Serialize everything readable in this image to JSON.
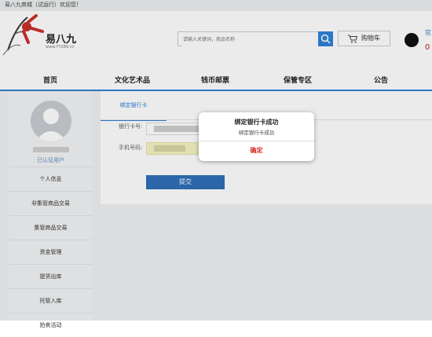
{
  "topbar": {
    "welcome": "易八九商城（试运行）欢迎您！"
  },
  "header": {
    "brand": "易八九",
    "domain": "www.YY289.cn",
    "search_placeholder": "请输入关键词，商品名称",
    "cart_label": "购物车",
    "corner_link": "官",
    "corner_number": "0"
  },
  "nav": {
    "items": [
      "首页",
      "文化艺术品",
      "钱币邮票",
      "保管专区",
      "公告"
    ]
  },
  "sidebar": {
    "verified": "已认证用户",
    "menu": [
      "个人信息",
      "非集管商品交易",
      "集管商品交易",
      "资金管理",
      "提货出库",
      "托管入库",
      "拍卖活动"
    ]
  },
  "content": {
    "tab": "绑定银行卡",
    "card_label": "银行卡号:",
    "phone_label": "手机号码:",
    "submit": "提交"
  },
  "modal": {
    "title": "绑定银行卡成功",
    "message": "绑定银行卡成功",
    "ok": "确定"
  },
  "colors": {
    "accent": "#2f7fd6",
    "danger": "#d9281c",
    "submit_bg": "#2f6fb8"
  }
}
